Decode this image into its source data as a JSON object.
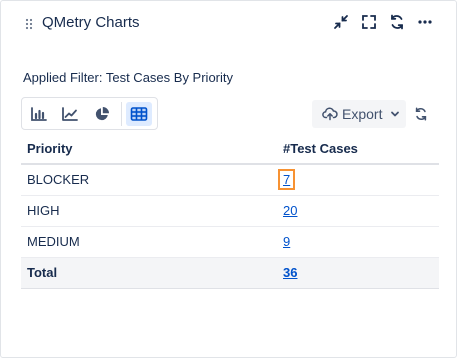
{
  "header": {
    "title": "QMetry Charts",
    "icons": [
      "drag-handle-icon",
      "collapse-icon",
      "fullscreen-icon",
      "refresh-icon",
      "more-icon"
    ]
  },
  "filter": {
    "label": "Applied Filter: Test Cases By Priority"
  },
  "chart_types": [
    {
      "name": "bar-chart-icon",
      "active": false
    },
    {
      "name": "line-chart-icon",
      "active": false
    },
    {
      "name": "pie-chart-icon",
      "active": false
    },
    {
      "name": "table-icon",
      "active": true
    }
  ],
  "toolbar": {
    "export_label": "Export"
  },
  "table": {
    "headers": [
      "Priority",
      "#Test Cases"
    ],
    "rows": [
      {
        "priority": "BLOCKER",
        "count": "7"
      },
      {
        "priority": "HIGH",
        "count": "20"
      },
      {
        "priority": "MEDIUM",
        "count": "9"
      }
    ],
    "total": {
      "label": "Total",
      "count": "36"
    }
  },
  "colors": {
    "accent": "#0052cc",
    "highlight": "#f79232",
    "text": "#172b4d",
    "icon": "#42526e"
  }
}
